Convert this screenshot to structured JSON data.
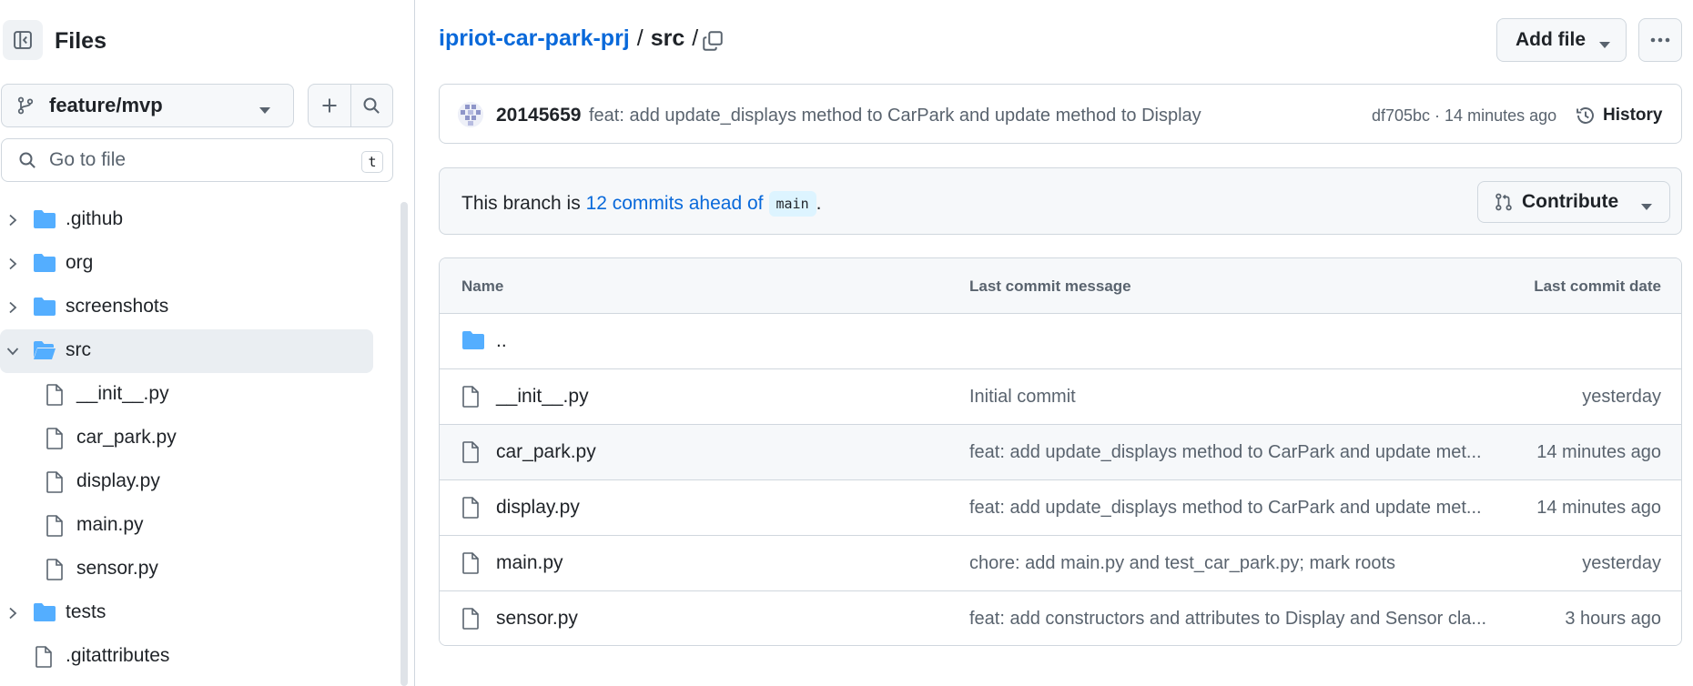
{
  "sidebar": {
    "title": "Files",
    "branch": "feature/mvp",
    "goto_placeholder": "Go to file",
    "goto_shortcut": "t",
    "tree": [
      {
        "label": ".github",
        "type": "folder",
        "expanded": false
      },
      {
        "label": "org",
        "type": "folder",
        "expanded": false
      },
      {
        "label": "screenshots",
        "type": "folder",
        "expanded": false
      },
      {
        "label": "src",
        "type": "folder",
        "expanded": true,
        "selected": true
      },
      {
        "label": "__init__.py",
        "type": "file"
      },
      {
        "label": "car_park.py",
        "type": "file"
      },
      {
        "label": "display.py",
        "type": "file"
      },
      {
        "label": "main.py",
        "type": "file"
      },
      {
        "label": "sensor.py",
        "type": "file"
      },
      {
        "label": "tests",
        "type": "folder",
        "expanded": false
      },
      {
        "label": ".gitattributes",
        "type": "file"
      }
    ]
  },
  "header": {
    "repo": "ipriot-car-park-prj",
    "sep1": "/",
    "current": "src",
    "sep2": "/",
    "add_file": "Add file"
  },
  "commit": {
    "author": "20145659",
    "message": "feat: add update_displays method to CarPark and update method to Display",
    "sha_time": "df705bc · 14 minutes ago",
    "history": "History"
  },
  "branch_info": {
    "prefix": "This branch is ",
    "link": "12 commits ahead of",
    "base": "main",
    "suffix": ".",
    "contribute": "Contribute"
  },
  "table": {
    "headers": {
      "name": "Name",
      "message": "Last commit message",
      "date": "Last commit date"
    },
    "parent": "..",
    "rows": [
      {
        "name": "__init__.py",
        "message": "Initial commit",
        "date": "yesterday"
      },
      {
        "name": "car_park.py",
        "message": "feat: add update_displays method to CarPark and update met...",
        "date": "14 minutes ago"
      },
      {
        "name": "display.py",
        "message": "feat: add update_displays method to CarPark and update met...",
        "date": "14 minutes ago"
      },
      {
        "name": "main.py",
        "message": "chore: add main.py and test_car_park.py; mark roots",
        "date": "yesterday"
      },
      {
        "name": "sensor.py",
        "message": "feat: add constructors and attributes to Display and Sensor cla...",
        "date": "3 hours ago"
      }
    ]
  },
  "colors": {
    "link": "#0969da",
    "folder": "#54aeff",
    "muted": "#59636e",
    "border": "#d0d7de"
  },
  "icons": [
    "sidebar-collapse-icon",
    "git-branch-icon",
    "plus-icon",
    "search-icon",
    "chevron-right-icon",
    "chevron-down-icon",
    "folder-icon",
    "folder-open-icon",
    "file-icon",
    "copy-icon",
    "kebab-horizontal-icon",
    "history-icon",
    "git-pull-request-icon",
    "triangle-down-icon"
  ]
}
